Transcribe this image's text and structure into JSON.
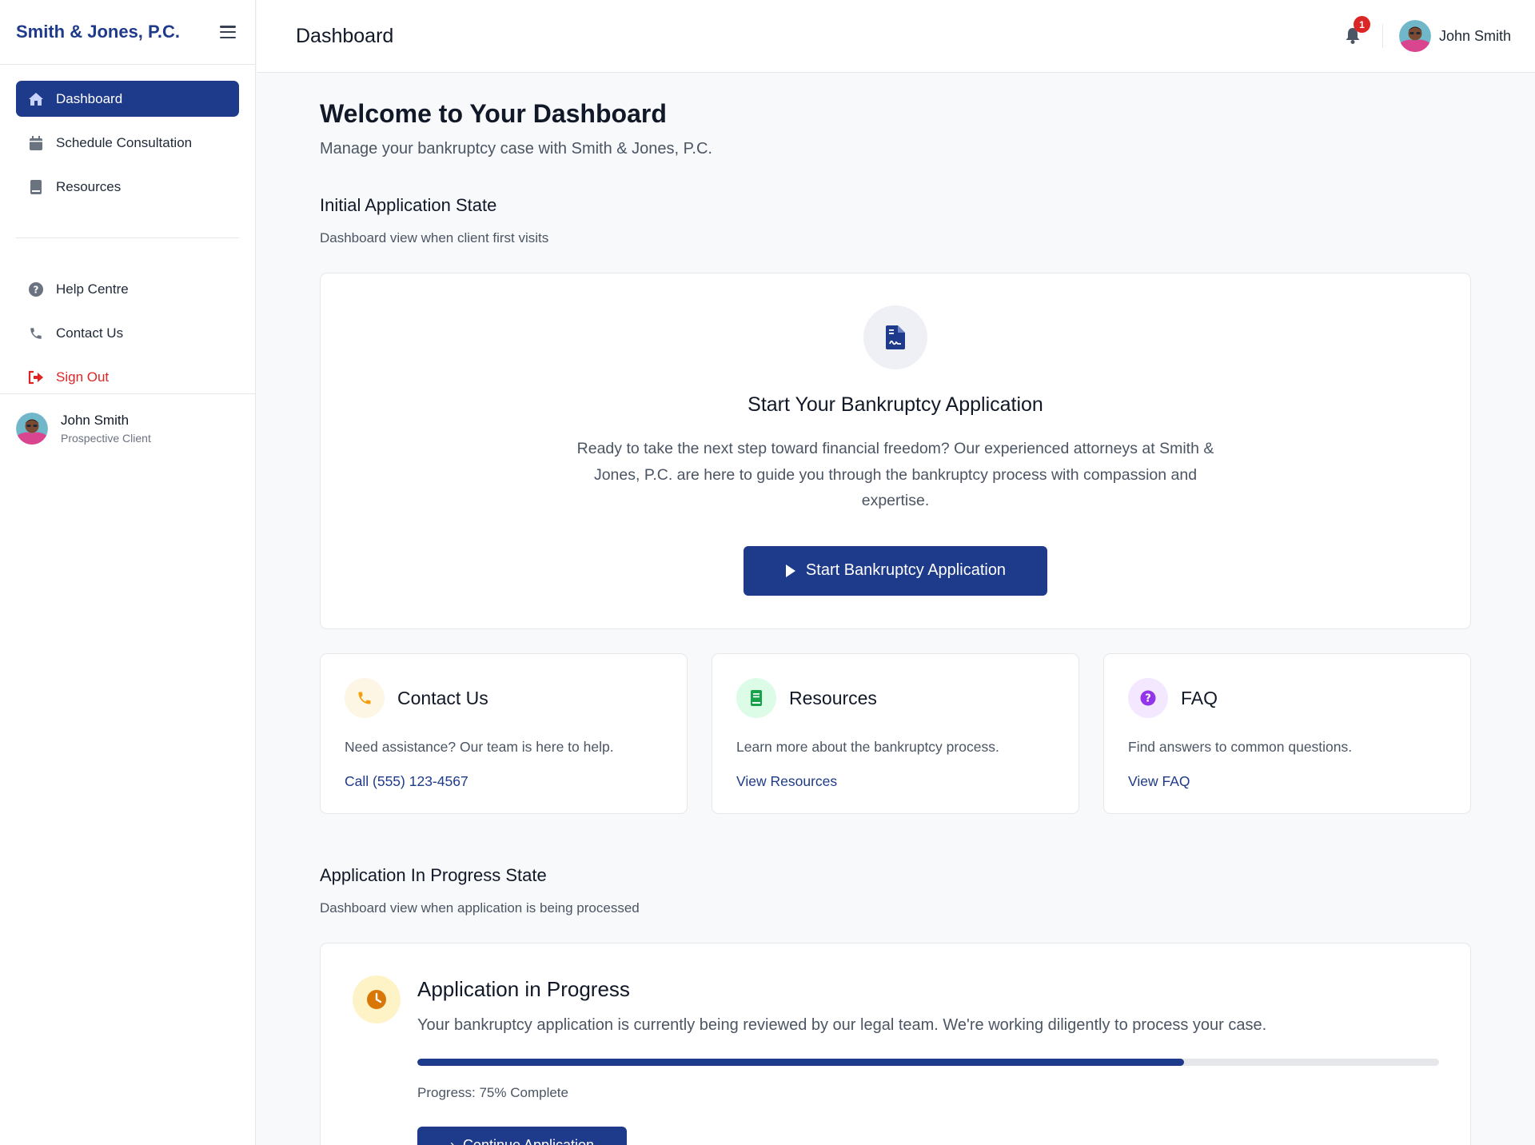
{
  "brand": "Smith & Jones, P.C.",
  "sidebar": {
    "nav_primary": [
      {
        "label": "Dashboard",
        "icon": "home-icon",
        "active": true
      },
      {
        "label": "Schedule Consultation",
        "icon": "calendar-icon"
      },
      {
        "label": "Resources",
        "icon": "book-icon"
      }
    ],
    "nav_secondary": [
      {
        "label": "Help Centre",
        "icon": "question-circle-icon"
      },
      {
        "label": "Contact Us",
        "icon": "phone-icon"
      },
      {
        "label": "Sign Out",
        "icon": "sign-out-icon"
      }
    ],
    "user": {
      "name": "John Smith",
      "role": "Prospective Client"
    }
  },
  "header": {
    "title": "Dashboard",
    "notification_count": "1",
    "user_name": "John Smith"
  },
  "main": {
    "welcome_title": "Welcome to Your Dashboard",
    "welcome_subtitle": "Manage your bankruptcy case with Smith & Jones, P.C.",
    "initial_state": {
      "title": "Initial Application State",
      "subtitle": "Dashboard view when client first visits",
      "hero": {
        "icon": "document-signature-icon",
        "title": "Start Your Bankruptcy Application",
        "text": "Ready to take the next step toward financial freedom? Our experienced attorneys at Smith & Jones, P.C. are here to guide you through the bankruptcy process with compassion and expertise.",
        "button_label": "Start Bankruptcy Application"
      },
      "cards": [
        {
          "title": "Contact Us",
          "text": "Need assistance? Our team is here to help.",
          "link": "Call (555) 123-4567",
          "icon": "phone-icon"
        },
        {
          "title": "Resources",
          "text": "Learn more about the bankruptcy process.",
          "link": "View Resources",
          "icon": "book-icon"
        },
        {
          "title": "FAQ",
          "text": "Find answers to common questions.",
          "link": "View FAQ",
          "icon": "question-circle-icon"
        }
      ]
    },
    "progress_state": {
      "title": "Application In Progress State",
      "subtitle": "Dashboard view when application is being processed",
      "card": {
        "icon": "clock-icon",
        "title": "Application in Progress",
        "text": "Your bankruptcy application is currently being reviewed by our legal team. We're working diligently to process your case.",
        "progress_percent": 75,
        "progress_label": "Progress: 75% Complete",
        "button_label": "Continue Application"
      }
    }
  },
  "colors": {
    "primary": "#1e3a8a",
    "danger": "#dc2626",
    "phone_accent": "#f59e0b",
    "resources_accent": "#16a34a",
    "faq_accent": "#9333ea",
    "progress_accent": "#d97706"
  }
}
